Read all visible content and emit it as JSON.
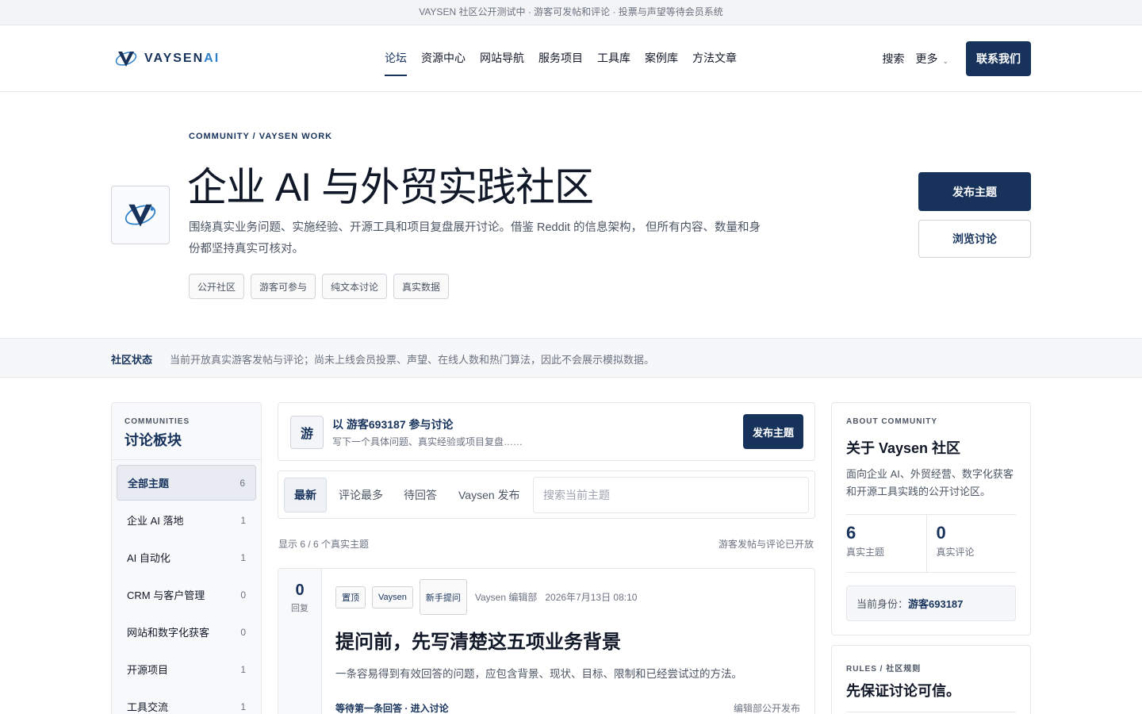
{
  "announcement": "VAYSEN 社区公开测试中 · 游客可发帖和评论 · 投票与声望等待会员系统",
  "brand": {
    "name_main": "VAYSEN",
    "name_accent": "AI",
    "primary_color": "#17335c",
    "accent_color": "#2f80c8"
  },
  "nav": {
    "items": [
      {
        "label": "论坛",
        "active": true
      },
      {
        "label": "资源中心"
      },
      {
        "label": "网站导航"
      },
      {
        "label": "服务项目"
      },
      {
        "label": "工具库"
      },
      {
        "label": "案例库"
      },
      {
        "label": "方法文章"
      }
    ],
    "search": "搜索",
    "more": "更多",
    "more_icon": "chevron-down-icon",
    "contact": "联系我们"
  },
  "hero": {
    "eyebrow": "COMMUNITY / VAYSEN WORK",
    "title": "企业 AI 与外贸实践社区",
    "description": "围绕真实业务问题、实施经验、开源工具和项目复盘展开讨论。借鉴 Reddit 的信息架构， 但所有内容、数量和身份都坚持真实可核对。",
    "tags": [
      "公开社区",
      "游客可参与",
      "纯文本讨论",
      "真实数据"
    ],
    "primary_button": "发布主题",
    "secondary_button": "浏览讨论"
  },
  "status": {
    "label": "社区状态",
    "text": "当前开放真实游客发帖与评论；尚未上线会员投票、声望、在线人数和热门算法，因此不会展示模拟数据。"
  },
  "sidebar": {
    "eyebrow": "COMMUNITIES",
    "title": "讨论板块",
    "items": [
      {
        "label": "全部主题",
        "count": "6",
        "active": true
      },
      {
        "label": "企业 AI 落地",
        "count": "1"
      },
      {
        "label": "AI 自动化",
        "count": "1"
      },
      {
        "label": "CRM 与客户管理",
        "count": "0"
      },
      {
        "label": "网站和数字化获客",
        "count": "0"
      },
      {
        "label": "开源项目",
        "count": "1"
      },
      {
        "label": "工具交流",
        "count": "1"
      }
    ]
  },
  "composer": {
    "avatar": "游",
    "title": "以 游客693187 参与讨论",
    "hint": "写下一个具体问题、真实经验或项目复盘……",
    "button": "发布主题"
  },
  "filters": {
    "tabs": [
      "最新",
      "评论最多",
      "待回答",
      "Vaysen 发布"
    ],
    "active_index": 0,
    "search_placeholder": "搜索当前主题"
  },
  "listing": {
    "summary": "显示 6 / 6 个真实主题",
    "notice": "游客发帖与评论已开放"
  },
  "posts": [
    {
      "reply_count": "0",
      "reply_label": "回复",
      "badges": [
        "置顶",
        "Vaysen",
        "新手提问"
      ],
      "author": "Vaysen 编辑部",
      "date": "2026年7月13日 08:10",
      "title": "提问前，先写清楚这五项业务背景",
      "excerpt": "一条容易得到有效回答的问题，应包含背景、现状、目标、限制和已经尝试过的方法。",
      "footer_left": "等待第一条回答 · 进入讨论",
      "footer_right": "编辑部公开发布"
    }
  ],
  "about": {
    "eyebrow": "ABOUT COMMUNITY",
    "title": "关于 Vaysen 社区",
    "description": "面向企业 AI、外贸经营、数字化获客和开源工具实践的公开讨论区。",
    "stats": [
      {
        "value": "6",
        "label": "真实主题"
      },
      {
        "value": "0",
        "label": "真实评论"
      }
    ],
    "identity_label": "当前身份：",
    "identity_value": "游客693187"
  },
  "rules": {
    "eyebrow": "RULES / 社区规则",
    "title": "先保证讨论可信。"
  }
}
